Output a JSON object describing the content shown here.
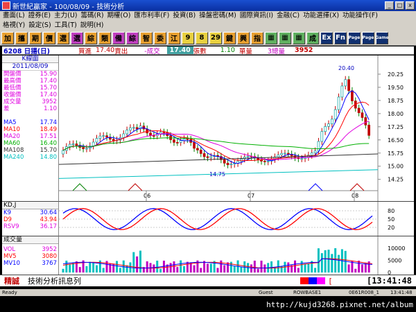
{
  "window": {
    "title": "新世紀贏家 - 100/08/09 - 技術分析",
    "min": "_",
    "max": "□",
    "close": "x"
  },
  "menu_row1": [
    "畫面(L)",
    "證券(E)",
    "主力(U)",
    "籌碼(R)",
    "期權(O)",
    "匯市利率(F)",
    "投資(B)",
    "操盤密碼(M)",
    "國際資訊(I)",
    "金融(C)",
    "功能選擇(X)",
    "功能操作(F)"
  ],
  "menu_row2": [
    "格視(Y)",
    "設定(S)",
    "工具(T)",
    "說明(H)"
  ],
  "toolbar": [
    {
      "g": "加",
      "bg": "#e8a030"
    },
    {
      "g": "攜",
      "bg": "#e8a030"
    },
    {
      "g": "期",
      "bg": "#e8a030"
    },
    {
      "g": "價",
      "bg": "#e8a030"
    },
    {
      "g": "選",
      "bg": "#e8a030"
    },
    {
      "g": "選",
      "bg": "#c040c0"
    },
    {
      "g": "綜",
      "bg": "#e8a030"
    },
    {
      "g": "類",
      "bg": "#e8a030"
    },
    {
      "g": "備",
      "bg": "#c040c0"
    },
    {
      "g": "綜",
      "bg": "#c040c0"
    },
    {
      "g": "智",
      "bg": "#e8a030"
    },
    {
      "g": "委",
      "bg": "#e8a030"
    },
    {
      "g": "江",
      "bg": "#e8a030"
    },
    {
      "g": "9",
      "bg": "#e8d040"
    },
    {
      "g": "8",
      "bg": "#e8d040"
    },
    {
      "g": "29",
      "bg": "#e8d040"
    },
    {
      "g": "鍵",
      "bg": "#e8a030"
    },
    {
      "g": "興",
      "bg": "#e8a030"
    },
    {
      "g": "指",
      "bg": "#e8a030"
    },
    {
      "g": "▦",
      "bg": "#60b060"
    },
    {
      "g": "▦",
      "bg": "#60b060"
    },
    {
      "g": "▦",
      "bg": "#60b060"
    },
    {
      "g": "成",
      "bg": "#60b060"
    },
    {
      "g": "Ex",
      "bg": "#103070"
    },
    {
      "g": "Fn",
      "bg": "#103070"
    },
    {
      "g": "Page",
      "bg": "#103070"
    },
    {
      "g": "Page",
      "bg": "#103070"
    },
    {
      "g": "Game",
      "bg": "#103070"
    }
  ],
  "quote": {
    "code": "6208 日揚(日)",
    "buy_label": "買進",
    "buy": "17.40",
    "sell_label": "賣出",
    "chg_label": "-成交",
    "last": "17.40",
    "vol_label": "張數",
    "vol": "1.10",
    "unit_label": "單量",
    "tv_label": "3總量",
    "tv": "3952"
  },
  "kpanel": {
    "title": "K線圖",
    "date": "2011/08/09",
    "rows": [
      {
        "k": "開盤價",
        "v": "15.90",
        "c": "#e000e0"
      },
      {
        "k": "最高價",
        "v": "17.40",
        "c": "#e000e0"
      },
      {
        "k": "最低價",
        "v": "15.70",
        "c": "#e000e0"
      },
      {
        "k": "收盤價",
        "v": "17.40",
        "c": "#e000e0"
      },
      {
        "k": "成交量",
        "v": "3952",
        "c": "#e000e0"
      },
      {
        "k": "差",
        "v": "1.10",
        "c": "#e000e0"
      },
      {
        "k": "",
        "v": "",
        "c": "#000"
      },
      {
        "k": "MA5",
        "v": "17.74",
        "c": "#0000ff"
      },
      {
        "k": "MA10",
        "v": "18.49",
        "c": "#ff0000"
      },
      {
        "k": "MA20",
        "v": "17.51",
        "c": "#e000e0"
      },
      {
        "k": "MA60",
        "v": "16.40",
        "c": "#00b000"
      },
      {
        "k": "MA108",
        "v": "15.70",
        "c": "#333333"
      },
      {
        "k": "MA240",
        "v": "14.80",
        "c": "#00c0c0"
      }
    ]
  },
  "kdpanel": {
    "title": "KD,J",
    "rows": [
      {
        "k": "K9",
        "v": "30.64",
        "c": "#0000ff"
      },
      {
        "k": "D9",
        "v": "43.94",
        "c": "#ff0000"
      },
      {
        "k": "RSV9",
        "v": "36.17",
        "c": "#e000e0"
      }
    ]
  },
  "volpanel": {
    "title": "成交量",
    "rows": [
      {
        "k": "VOL",
        "v": "3952",
        "c": "#e000e0"
      },
      {
        "k": "MV5",
        "v": "3080",
        "c": "#ff0000"
      },
      {
        "k": "MV10",
        "v": "3767",
        "c": "#0000ff"
      }
    ]
  },
  "chart_data": {
    "type": "candlestick",
    "price_ticks": [
      "20.25",
      "19.50",
      "18.75",
      "18.00",
      "17.25",
      "16.50",
      "15.75",
      "15.00",
      "14.25"
    ],
    "price_range": [
      14.0,
      21.0
    ],
    "high_label": "20.40",
    "low_label": "14.75",
    "months": [
      "06",
      "07",
      "08"
    ],
    "kd_ticks": [
      "80",
      "50",
      "20"
    ],
    "vol_ticks": [
      "10000",
      "5000",
      "0"
    ],
    "vol_range": [
      0,
      12000
    ]
  },
  "status": {
    "brand": "精誠",
    "msg": "技術分析訊息列",
    "bracket": "[",
    "bracket2": "[",
    "clock": "13:41:48"
  },
  "bottom": {
    "ready": "Ready",
    "guest": "Guest",
    "srv": "ROWBASE1",
    "code": "0E61R008_1",
    "time": "13:41:48"
  },
  "url": "http://kujd3268.pixnet.net/album"
}
